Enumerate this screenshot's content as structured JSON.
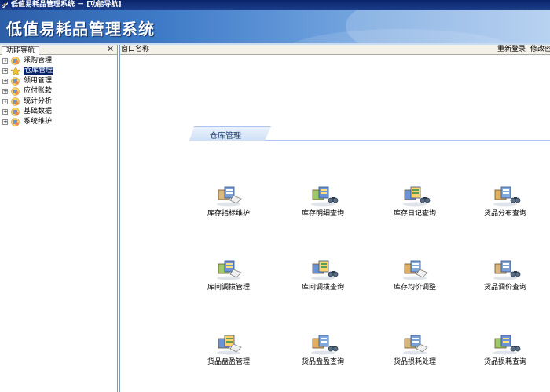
{
  "window": {
    "title": "低值易耗品管理系统 － [功能导航]"
  },
  "banner": {
    "title": "低值易耗品管理系统"
  },
  "nav": {
    "tab_label": "功能导航",
    "items": [
      {
        "label": "采购管理",
        "selected": false
      },
      {
        "label": "仓库管理",
        "selected": true
      },
      {
        "label": "领用管理",
        "selected": false
      },
      {
        "label": "应付账款",
        "selected": false
      },
      {
        "label": "统计分析",
        "selected": false
      },
      {
        "label": "基础数据",
        "selected": false
      },
      {
        "label": "系统维护",
        "selected": false
      }
    ]
  },
  "main": {
    "window_name_label": "窗口名称",
    "relogin_link": "重新登录",
    "change_password_link": "修改密"
  },
  "section": {
    "title": "仓库管理"
  },
  "functions": [
    {
      "label": "库存指标维护",
      "icon": "maintenance-icon"
    },
    {
      "label": "库存明细查询",
      "icon": "detail-query-icon"
    },
    {
      "label": "库存日记查询",
      "icon": "journal-query-icon"
    },
    {
      "label": "货品分布查询",
      "icon": "distribution-query-icon"
    },
    {
      "label": "库间调拨管理",
      "icon": "transfer-manage-icon"
    },
    {
      "label": "库间调拨查询",
      "icon": "transfer-query-icon"
    },
    {
      "label": "库存均价调整",
      "icon": "price-adjust-icon"
    },
    {
      "label": "货品调价查询",
      "icon": "price-query-icon"
    },
    {
      "label": "货品盘盈管理",
      "icon": "surplus-manage-icon"
    },
    {
      "label": "货品盘盈查询",
      "icon": "surplus-query-icon"
    },
    {
      "label": "货品损耗处理",
      "icon": "loss-process-icon"
    },
    {
      "label": "货品损耗查询",
      "icon": "loss-query-icon"
    }
  ],
  "colors": {
    "titlebar": "#0a246a",
    "banner": "#3f7bc8",
    "selection": "#0a246a"
  }
}
